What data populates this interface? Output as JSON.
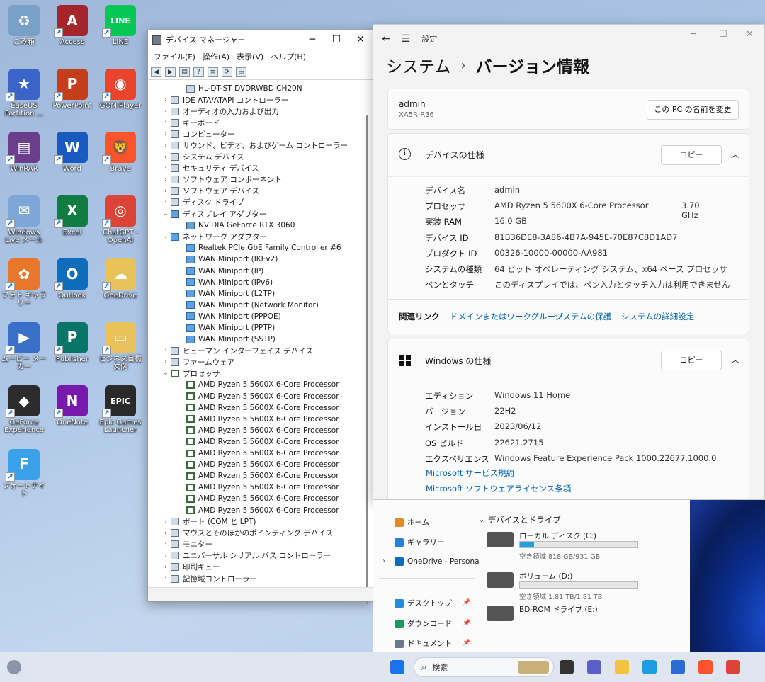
{
  "desktop_icons": [
    {
      "label": "ごみ箱",
      "color": "#7aa0c8",
      "glyph": "♻"
    },
    {
      "label": "Access",
      "color": "#a4262c",
      "glyph": "A"
    },
    {
      "label": "LINE",
      "color": "#06c755",
      "glyph": "LINE"
    },
    {
      "label": "EaseUS Partition ...",
      "color": "#3a64c8",
      "glyph": "★"
    },
    {
      "label": "PowerPoint",
      "color": "#c43e1c",
      "glyph": "P"
    },
    {
      "label": "GOM Player",
      "color": "#e8452c",
      "glyph": "◉"
    },
    {
      "label": "WinRAR",
      "color": "#6b3e8c",
      "glyph": "▤"
    },
    {
      "label": "Word",
      "color": "#185abd",
      "glyph": "W"
    },
    {
      "label": "Brave",
      "color": "#fb542b",
      "glyph": "🦁"
    },
    {
      "label": "Windows Live メール",
      "color": "#7ea7d8",
      "glyph": "✉"
    },
    {
      "label": "Excel",
      "color": "#107c41",
      "glyph": "X"
    },
    {
      "label": "ChatGPT - OpenAI",
      "color": "#db4437",
      "glyph": "◎"
    },
    {
      "label": "フォト ギャラリー",
      "color": "#e8762b",
      "glyph": "✿"
    },
    {
      "label": "Outlook",
      "color": "#0f6cbd",
      "glyph": "O"
    },
    {
      "label": "OneDrive",
      "color": "#e8c35a",
      "glyph": "☁"
    },
    {
      "label": "ムービー メーカー",
      "color": "#3a6fc8",
      "glyph": "▶"
    },
    {
      "label": "Publisher",
      "color": "#077568",
      "glyph": "P"
    },
    {
      "label": "ビジネス目標 文例",
      "color": "#e8c35a",
      "glyph": "▭"
    },
    {
      "label": "GeForce Experience",
      "color": "#2c2c2c",
      "glyph": "◆"
    },
    {
      "label": "OneNote",
      "color": "#7719aa",
      "glyph": "N"
    },
    {
      "label": "Epic Games Launcher",
      "color": "#2a2a2a",
      "glyph": "EPIC"
    },
    {
      "label": "フォートナイト",
      "color": "#3aa0e8",
      "glyph": "F"
    }
  ],
  "device_manager": {
    "title": "デバイス マネージャー",
    "menus": [
      "ファイル(F)",
      "操作(A)",
      "表示(V)",
      "ヘルプ(H)"
    ],
    "tree": [
      {
        "label": "HL-DT-ST DVDRWBD CH20N",
        "level": 1,
        "icon": "dev"
      },
      {
        "label": "IDE ATA/ATAPI コントローラー",
        "level": 0,
        "icon": "dev",
        "chev": "›"
      },
      {
        "label": "オーディオの入力および出力",
        "level": 0,
        "icon": "dev",
        "chev": "›"
      },
      {
        "label": "キーボード",
        "level": 0,
        "icon": "dev",
        "chev": "›"
      },
      {
        "label": "コンピューター",
        "level": 0,
        "icon": "dev",
        "chev": "›"
      },
      {
        "label": "サウンド、ビデオ、およびゲーム コントローラー",
        "level": 0,
        "icon": "dev",
        "chev": "›"
      },
      {
        "label": "システム デバイス",
        "level": 0,
        "icon": "dev",
        "chev": "›"
      },
      {
        "label": "セキュリティ デバイス",
        "level": 0,
        "icon": "dev",
        "chev": "›"
      },
      {
        "label": "ソフトウェア コンポーネント",
        "level": 0,
        "icon": "dev",
        "chev": "›"
      },
      {
        "label": "ソフトウェア デバイス",
        "level": 0,
        "icon": "dev",
        "chev": "›"
      },
      {
        "label": "ディスク ドライブ",
        "level": 0,
        "icon": "dev",
        "chev": "›"
      },
      {
        "label": "ディスプレイ アダプター",
        "level": 0,
        "icon": "gpu",
        "chev": "⌄"
      },
      {
        "label": "NVIDIA GeForce RTX 3060",
        "level": 1,
        "icon": "gpu"
      },
      {
        "label": "ネットワーク アダプター",
        "level": 0,
        "icon": "net",
        "chev": "⌄"
      },
      {
        "label": "Realtek PCIe GbE Family Controller #6",
        "level": 1,
        "icon": "net"
      },
      {
        "label": "WAN Miniport (IKEv2)",
        "level": 1,
        "icon": "net"
      },
      {
        "label": "WAN Miniport (IP)",
        "level": 1,
        "icon": "net"
      },
      {
        "label": "WAN Miniport (IPv6)",
        "level": 1,
        "icon": "net"
      },
      {
        "label": "WAN Miniport (L2TP)",
        "level": 1,
        "icon": "net"
      },
      {
        "label": "WAN Miniport (Network Monitor)",
        "level": 1,
        "icon": "net"
      },
      {
        "label": "WAN Miniport (PPPOE)",
        "level": 1,
        "icon": "net"
      },
      {
        "label": "WAN Miniport (PPTP)",
        "level": 1,
        "icon": "net"
      },
      {
        "label": "WAN Miniport (SSTP)",
        "level": 1,
        "icon": "net"
      },
      {
        "label": "ヒューマン インターフェイス デバイス",
        "level": 0,
        "icon": "dev",
        "chev": "›"
      },
      {
        "label": "ファームウェア",
        "level": 0,
        "icon": "dev",
        "chev": "›"
      },
      {
        "label": "プロセッサ",
        "level": 0,
        "icon": "cpu",
        "chev": "⌄"
      },
      {
        "label": "AMD Ryzen 5 5600X 6-Core Processor",
        "level": 1,
        "icon": "cpu"
      },
      {
        "label": "AMD Ryzen 5 5600X 6-Core Processor",
        "level": 1,
        "icon": "cpu"
      },
      {
        "label": "AMD Ryzen 5 5600X 6-Core Processor",
        "level": 1,
        "icon": "cpu"
      },
      {
        "label": "AMD Ryzen 5 5600X 6-Core Processor",
        "level": 1,
        "icon": "cpu"
      },
      {
        "label": "AMD Ryzen 5 5600X 6-Core Processor",
        "level": 1,
        "icon": "cpu"
      },
      {
        "label": "AMD Ryzen 5 5600X 6-Core Processor",
        "level": 1,
        "icon": "cpu"
      },
      {
        "label": "AMD Ryzen 5 5600X 6-Core Processor",
        "level": 1,
        "icon": "cpu"
      },
      {
        "label": "AMD Ryzen 5 5600X 6-Core Processor",
        "level": 1,
        "icon": "cpu"
      },
      {
        "label": "AMD Ryzen 5 5600X 6-Core Processor",
        "level": 1,
        "icon": "cpu"
      },
      {
        "label": "AMD Ryzen 5 5600X 6-Core Processor",
        "level": 1,
        "icon": "cpu"
      },
      {
        "label": "AMD Ryzen 5 5600X 6-Core Processor",
        "level": 1,
        "icon": "cpu"
      },
      {
        "label": "AMD Ryzen 5 5600X 6-Core Processor",
        "level": 1,
        "icon": "cpu"
      },
      {
        "label": "ポート (COM と LPT)",
        "level": 0,
        "icon": "dev",
        "chev": "›"
      },
      {
        "label": "マウスとそのほかのポインティング デバイス",
        "level": 0,
        "icon": "dev",
        "chev": "›"
      },
      {
        "label": "モニター",
        "level": 0,
        "icon": "dev",
        "chev": "›"
      },
      {
        "label": "ユニバーサル シリアル バス コントローラー",
        "level": 0,
        "icon": "dev",
        "chev": "›"
      },
      {
        "label": "印刷キュー",
        "level": 0,
        "icon": "dev",
        "chev": "›"
      },
      {
        "label": "記憶域コントローラー",
        "level": 0,
        "icon": "dev",
        "chev": "›"
      }
    ]
  },
  "settings": {
    "app_title": "設定",
    "breadcrumb_parent": "システム",
    "breadcrumb_sep": "›",
    "breadcrumb_current": "バージョン情報",
    "pc_name": "admin",
    "pc_model": "XA5R-R36",
    "rename_button": "この PC の名前を変更",
    "device_spec": {
      "title": "デバイスの仕様",
      "copy_label": "コピー",
      "rows": [
        {
          "k": "デバイス名",
          "v": "admin",
          "extra": ""
        },
        {
          "k": "プロセッサ",
          "v": "AMD Ryzen 5 5600X 6-Core Processor",
          "extra": "3.70 GHz"
        },
        {
          "k": "実装 RAM",
          "v": "16.0 GB",
          "extra": ""
        },
        {
          "k": "デバイス ID",
          "v": "81B36DE8-3A86-4B7A-945E-70E87C8D1AD7",
          "extra": ""
        },
        {
          "k": "プロダクト ID",
          "v": "00326-10000-00000-AA981",
          "extra": ""
        },
        {
          "k": "システムの種類",
          "v": "64 ビット オペレーティング システム、x64 ベース プロセッサ",
          "extra": ""
        },
        {
          "k": "ペンとタッチ",
          "v": "このディスプレイでは、ペン入力とタッチ入力は利用できません",
          "extra": ""
        }
      ]
    },
    "related": {
      "label": "関連リンク",
      "links": [
        "ドメインまたはワークグループ",
        "システムの保護",
        "システムの詳細設定"
      ]
    },
    "windows_spec": {
      "title": "Windows の仕様",
      "copy_label": "コピー",
      "rows": [
        {
          "k": "エディション",
          "v": "Windows 11 Home"
        },
        {
          "k": "バージョン",
          "v": "22H2"
        },
        {
          "k": "インストール日",
          "v": "2023/06/12"
        },
        {
          "k": "OS ビルド",
          "v": "22621.2715"
        },
        {
          "k": "エクスペリエンス",
          "v": "Windows Feature Experience Pack 1000.22677.1000.0"
        }
      ],
      "links": [
        "Microsoft サービス規約",
        "Microsoft ソフトウェアライセンス条項"
      ]
    }
  },
  "explorer": {
    "nav": [
      {
        "label": "ホーム",
        "color": "#e08a2b"
      },
      {
        "label": "ギャラリー",
        "color": "#2b7fd8"
      },
      {
        "label": "OneDrive - Persona",
        "color": "#0f6cbd"
      },
      {
        "label": "デスクトップ",
        "color": "#2b8ad8"
      },
      {
        "label": "ダウンロード",
        "color": "#1c9a5a"
      },
      {
        "label": "ドキュメント",
        "color": "#6b7a8c"
      }
    ],
    "section_title": "デバイスとドライブ",
    "drives": [
      {
        "name": "ローカル ディスク (C:)",
        "free": "空き領域 818 GB/931 GB",
        "used_fraction": 0.12
      },
      {
        "name": "ボリューム (D:)",
        "free": "空き領域 1.81 TB/1.81 TB",
        "used_fraction": 0.0
      },
      {
        "name": "BD-ROM ドライブ (E:)",
        "free": "",
        "used_fraction": null
      }
    ]
  },
  "taskbar": {
    "search_placeholder": "検索",
    "icons": [
      {
        "name": "start-icon",
        "color": "#1a73e8"
      },
      {
        "name": "task-view-icon",
        "color": "#333333"
      },
      {
        "name": "chat-icon",
        "color": "#5b5fc7"
      },
      {
        "name": "file-explorer-icon",
        "color": "#f2c240"
      },
      {
        "name": "edge-icon",
        "color": "#1b9de2"
      },
      {
        "name": "store-icon",
        "color": "#2a6bd6"
      },
      {
        "name": "brave-icon",
        "color": "#fb542b"
      },
      {
        "name": "chrome-icon",
        "color": "#db4437"
      }
    ]
  }
}
